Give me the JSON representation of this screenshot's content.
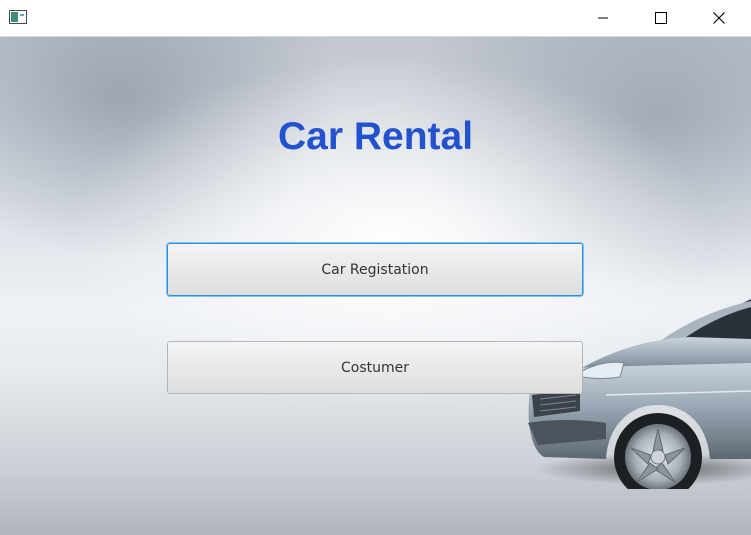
{
  "window": {
    "app_icon": "window-app-icon",
    "controls": {
      "minimize_icon": "minimize-icon",
      "maximize_icon": "maximize-icon",
      "close_icon": "close-icon"
    }
  },
  "main": {
    "title": "Car Rental",
    "title_color": "#2352cf",
    "buttons": {
      "car_registration_label": "Car Registation",
      "customer_label": "Costumer"
    },
    "focus_color": "#2c8ee0"
  },
  "background": {
    "image": "car-photo"
  }
}
